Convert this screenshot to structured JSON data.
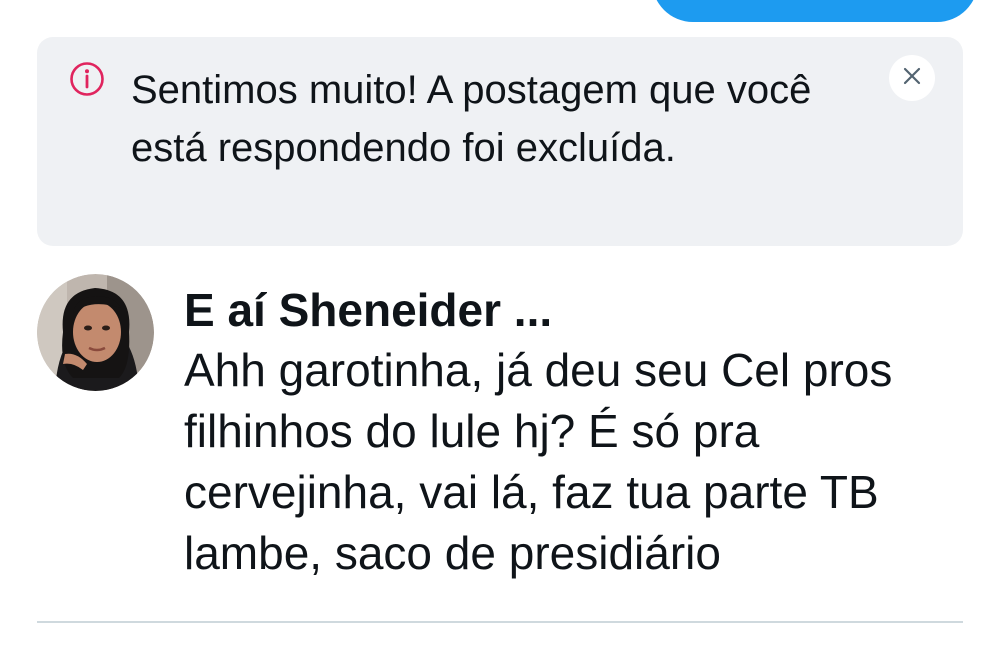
{
  "top_button": {
    "color": "#1d9bf0"
  },
  "notice": {
    "icon": "info-circle-icon",
    "icon_color": "#e0245e",
    "message": "Sentimos muito! A postagem que você está respondendo foi excluída.",
    "close_icon": "close-icon",
    "background": "#eff1f4"
  },
  "reply": {
    "avatar_icon": "user-avatar",
    "author": "E aí Sheneider ...",
    "text": "Ahh garotinha, já deu seu Cel pros filhinhos do lule hj? É só pra cervejinha, vai lá, faz tua parte TB lambe, saco de presidiário"
  }
}
